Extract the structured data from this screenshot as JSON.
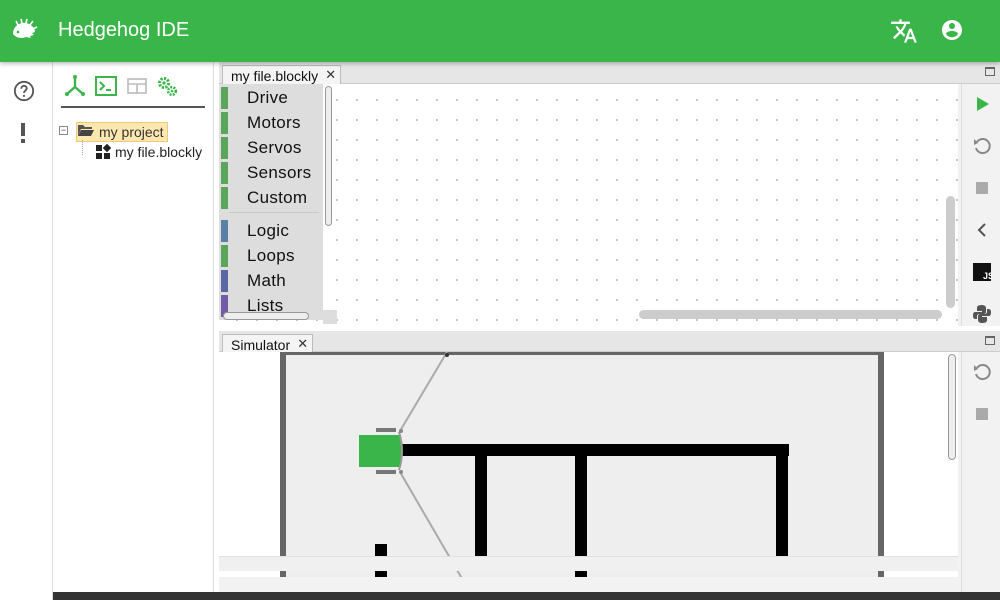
{
  "app": {
    "title": "Hedgehog IDE",
    "brand_color": "#3ab54a",
    "icons": [
      "hedgehog-logo-icon",
      "translate-icon",
      "account-circle-icon"
    ]
  },
  "left_rail": {
    "icons": [
      "help-circle-icon",
      "exclamation-icon"
    ]
  },
  "explorer": {
    "toolbar_icons": [
      "new-project-icon",
      "console-icon",
      "layout-icon",
      "settings-gears-icon"
    ],
    "tree": {
      "project_label": "my project",
      "file_label": "my file.blockly",
      "collapse_symbol": "−"
    }
  },
  "editor": {
    "tab_label": "my file.blockly",
    "tab_close": "✕",
    "toolbox": {
      "categories": [
        {
          "label": "Drive",
          "color": "#5ba55b"
        },
        {
          "label": "Motors",
          "color": "#5ba55b"
        },
        {
          "label": "Servos",
          "color": "#5ba55b"
        },
        {
          "label": "Sensors",
          "color": "#5ba55b"
        },
        {
          "label": "Custom",
          "color": "#5ba55b"
        },
        {
          "label": "Logic",
          "color": "#5b80a5"
        },
        {
          "label": "Loops",
          "color": "#5ba55b"
        },
        {
          "label": "Math",
          "color": "#5b67a5"
        },
        {
          "label": "Lists",
          "color": "#745ba5"
        }
      ]
    },
    "side_icons": [
      "run-icon",
      "reset-icon",
      "stop-icon",
      "collapse-left-icon",
      "javascript-icon",
      "python-icon"
    ],
    "js_label": "JS"
  },
  "simulator": {
    "tab_label": "Simulator",
    "tab_close": "✕",
    "side_icons": [
      "reset-icon",
      "stop-icon"
    ],
    "robot_color": "#3ab54a"
  }
}
